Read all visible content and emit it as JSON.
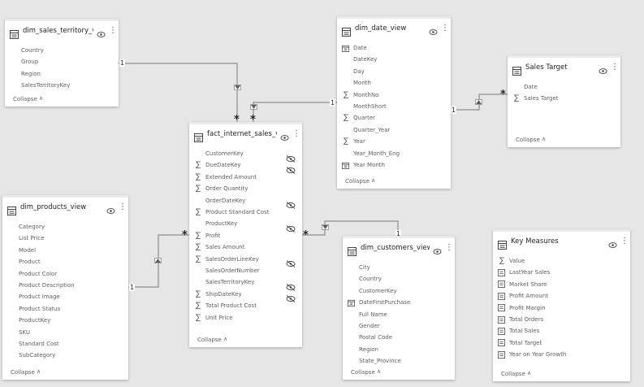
{
  "tables": {
    "sales_territory": {
      "title": "dim_sales_territory_vi...",
      "fields": [
        {
          "label": "Country",
          "icon": "none"
        },
        {
          "label": "Group",
          "icon": "none"
        },
        {
          "label": "Region",
          "icon": "none"
        },
        {
          "label": "SalesTerritoryKey",
          "icon": "none"
        }
      ],
      "collapse": "Collapse"
    },
    "date_view": {
      "title": "dim_date_view",
      "fields": [
        {
          "label": "Date",
          "icon": "calendar"
        },
        {
          "label": "DateKey",
          "icon": "none"
        },
        {
          "label": "Day",
          "icon": "none"
        },
        {
          "label": "Month",
          "icon": "none"
        },
        {
          "label": "MonthNo",
          "icon": "sum"
        },
        {
          "label": "MonthShort",
          "icon": "none"
        },
        {
          "label": "Quarter",
          "icon": "sum"
        },
        {
          "label": "Quarter_Year",
          "icon": "none"
        },
        {
          "label": "Year",
          "icon": "sum"
        },
        {
          "label": "Year_Month_Eng",
          "icon": "none"
        },
        {
          "label": "Year Month",
          "icon": "calendar"
        }
      ],
      "collapse": "Collapse"
    },
    "sales_target": {
      "title": "Sales Target",
      "fields": [
        {
          "label": "Date",
          "icon": "none"
        },
        {
          "label": "Sales Target",
          "icon": "sum"
        }
      ],
      "collapse": "Collapse"
    },
    "fact_sales": {
      "title": "fact_internet_sales_vi...",
      "fields": [
        {
          "label": "CustomerKey",
          "icon": "none",
          "hidden": true
        },
        {
          "label": "DueDateKey",
          "icon": "sum",
          "hidden": true
        },
        {
          "label": "Extended Amount",
          "icon": "sum"
        },
        {
          "label": "Order Quantity",
          "icon": "sum"
        },
        {
          "label": "OrderDateKey",
          "icon": "none",
          "hidden": true
        },
        {
          "label": "Product Standard Cost",
          "icon": "sum"
        },
        {
          "label": "ProductKey",
          "icon": "none",
          "hidden": true
        },
        {
          "label": "Profit",
          "icon": "sum"
        },
        {
          "label": "Sales Amount",
          "icon": "sum"
        },
        {
          "label": "SalesOrderLineKey",
          "icon": "sum",
          "hidden": true
        },
        {
          "label": "SalesOrderNumber",
          "icon": "none"
        },
        {
          "label": "SalesTerritoryKey",
          "icon": "none",
          "hidden": true
        },
        {
          "label": "ShipDateKey",
          "icon": "sum",
          "hidden": true
        },
        {
          "label": "Total Product Cost",
          "icon": "sum"
        },
        {
          "label": "Unit Price",
          "icon": "sum"
        }
      ],
      "collapse": "Collapse"
    },
    "products": {
      "title": "dim_products_view",
      "fields": [
        {
          "label": "Category",
          "icon": "none"
        },
        {
          "label": "List Price",
          "icon": "none"
        },
        {
          "label": "Model",
          "icon": "none"
        },
        {
          "label": "Product",
          "icon": "none"
        },
        {
          "label": "Product Color",
          "icon": "none"
        },
        {
          "label": "Product Description",
          "icon": "none"
        },
        {
          "label": "Product Image",
          "icon": "none"
        },
        {
          "label": "Product Status",
          "icon": "none"
        },
        {
          "label": "ProductKey",
          "icon": "none"
        },
        {
          "label": "SKU",
          "icon": "none"
        },
        {
          "label": "Standard Cost",
          "icon": "none"
        },
        {
          "label": "SubCategory",
          "icon": "none"
        }
      ],
      "collapse": "Collapse"
    },
    "customers": {
      "title": "dim_customers_view",
      "fields": [
        {
          "label": "City",
          "icon": "none"
        },
        {
          "label": "Country",
          "icon": "none"
        },
        {
          "label": "CustomerKey",
          "icon": "none"
        },
        {
          "label": "DateFirstPurchase",
          "icon": "calendar"
        },
        {
          "label": "Full Name",
          "icon": "none"
        },
        {
          "label": "Gender",
          "icon": "none"
        },
        {
          "label": "Postal Code",
          "icon": "none"
        },
        {
          "label": "Region",
          "icon": "none"
        },
        {
          "label": "State_Province",
          "icon": "none"
        }
      ],
      "collapse": "Collapse"
    },
    "key_measures": {
      "title": "Key Measures",
      "fields": [
        {
          "label": "Value",
          "icon": "sum"
        },
        {
          "label": "LastYear Sales",
          "icon": "measure"
        },
        {
          "label": "Market Share",
          "icon": "measure"
        },
        {
          "label": "Profit Amount",
          "icon": "measure"
        },
        {
          "label": "Profit Margin",
          "icon": "measure"
        },
        {
          "label": "Total Orders",
          "icon": "measure"
        },
        {
          "label": "Total Sales",
          "icon": "measure"
        },
        {
          "label": "Total Target",
          "icon": "measure"
        },
        {
          "label": "Year on Year Growth",
          "icon": "measure"
        }
      ],
      "collapse": "Collapse"
    }
  },
  "relationships": {
    "territory_one": "1",
    "territory_many": "*",
    "date_one": "1",
    "date_many": "*",
    "target_one": "1",
    "target_many": "*",
    "products_one": "1",
    "products_many": "*",
    "customers_one": "1",
    "customers_many": "*"
  },
  "colors": {
    "canvas": "#e6e6e6",
    "card": "#ffffff",
    "line": "#8c8c8c",
    "text": "#605e5c",
    "title": "#252423"
  }
}
